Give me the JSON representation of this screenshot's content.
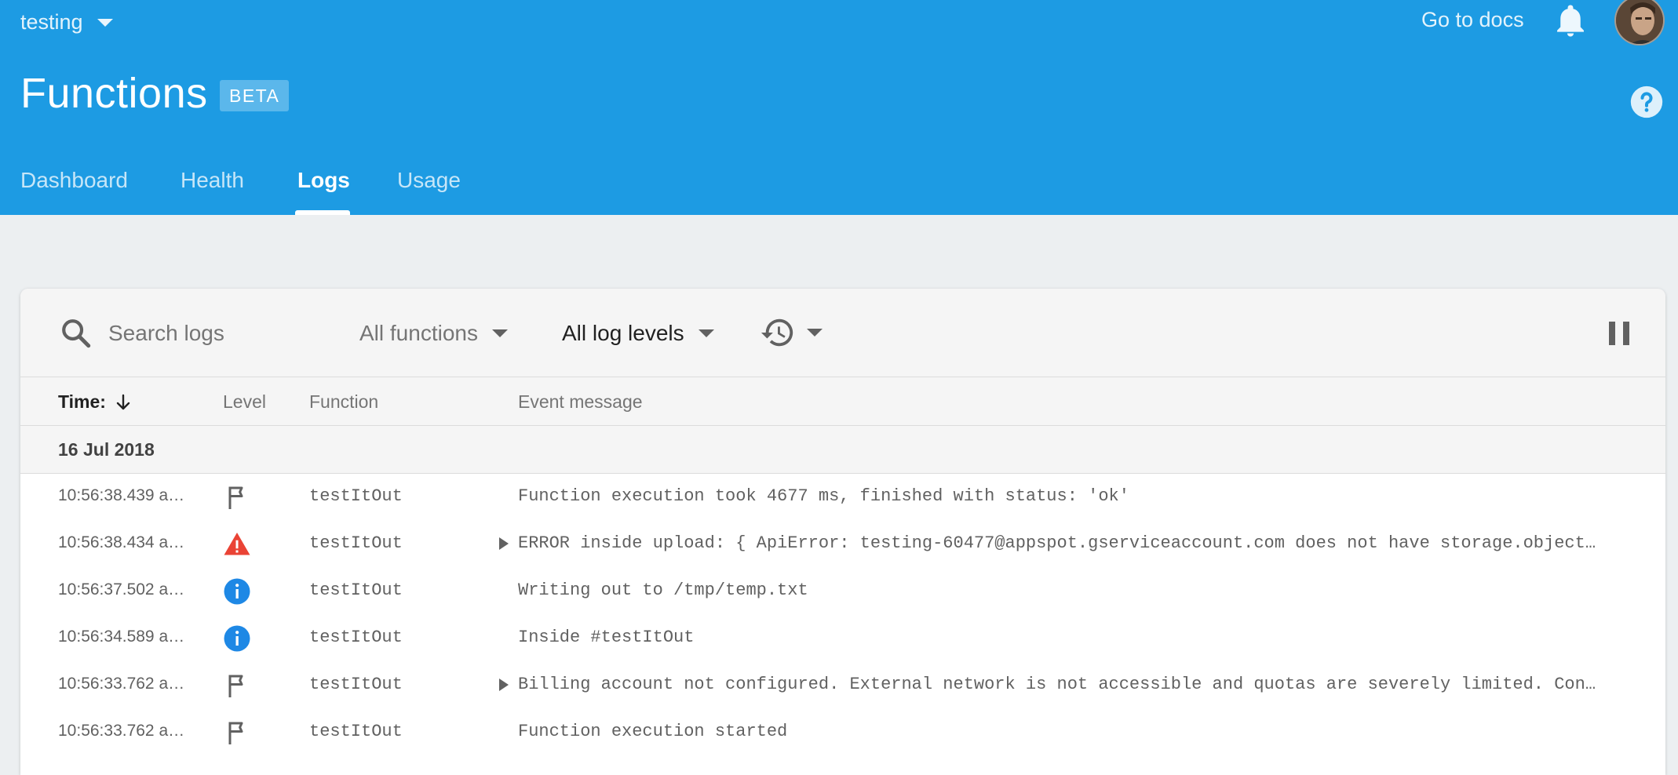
{
  "header": {
    "project_name": "testing",
    "docs_link": "Go to docs",
    "title": "Functions",
    "badge": "BETA",
    "tabs": [
      {
        "label": "Dashboard",
        "active": false
      },
      {
        "label": "Health",
        "active": false
      },
      {
        "label": "Logs",
        "active": true
      },
      {
        "label": "Usage",
        "active": false
      }
    ],
    "background_color": "#1d9be3"
  },
  "toolbar": {
    "search_placeholder": "Search logs",
    "functions_filter": "All functions",
    "levels_filter": "All log levels",
    "history_icon": "history-icon",
    "pause_icon": "pause-icon"
  },
  "table": {
    "columns": {
      "time": "Time:",
      "level": "Level",
      "function": "Function",
      "message": "Event message"
    },
    "date_group": "16 Jul 2018",
    "rows": [
      {
        "time": "10:56:38.439 a…",
        "level": "debug",
        "function": "testItOut",
        "expandable": false,
        "message": "Function execution took 4677 ms, finished with status: 'ok'"
      },
      {
        "time": "10:56:38.434 a…",
        "level": "error",
        "function": "testItOut",
        "expandable": true,
        "message": "ERROR inside upload: { ApiError: testing-60477@appspot.gserviceaccount.com does not have storage.object…"
      },
      {
        "time": "10:56:37.502 a…",
        "level": "info",
        "function": "testItOut",
        "expandable": false,
        "message": "Writing out to /tmp/temp.txt"
      },
      {
        "time": "10:56:34.589 a…",
        "level": "info",
        "function": "testItOut",
        "expandable": false,
        "message": "Inside #testItOut"
      },
      {
        "time": "10:56:33.762 a…",
        "level": "debug",
        "function": "testItOut",
        "expandable": true,
        "message": "Billing account not configured. External network is not accessible and quotas are severely limited. Con…"
      },
      {
        "time": "10:56:33.762 a…",
        "level": "debug",
        "function": "testItOut",
        "expandable": false,
        "message": "Function execution started"
      }
    ]
  },
  "colors": {
    "error": "#ea4335",
    "info": "#1e88e5",
    "debug": "#616161"
  }
}
